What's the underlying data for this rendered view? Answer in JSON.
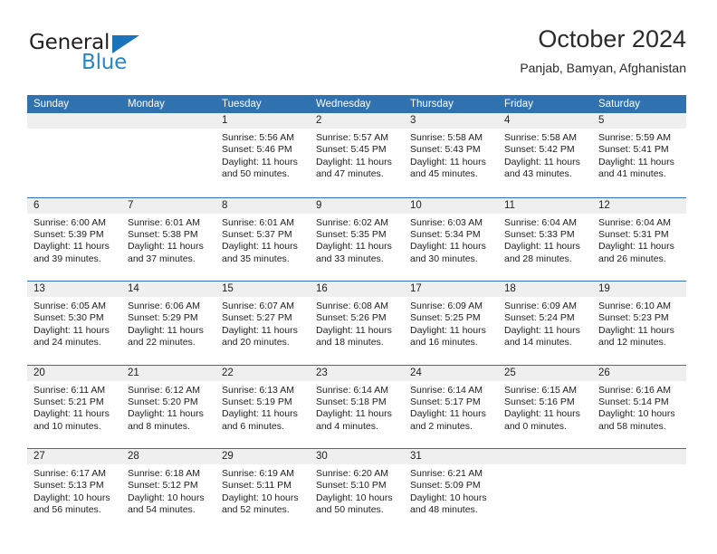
{
  "brand": {
    "name_part1": "General",
    "name_part2": "Blue",
    "triangle_color": "#1b74bb",
    "blue_color": "#2487c8"
  },
  "header": {
    "title": "October 2024",
    "subtitle": "Panjab, Bamyan, Afghanistan"
  },
  "theme": {
    "header_blue": "#3071b0",
    "day_band_gray": "#efefef",
    "text_color": "#222222"
  },
  "weekday_headers": [
    "Sunday",
    "Monday",
    "Tuesday",
    "Wednesday",
    "Thursday",
    "Friday",
    "Saturday"
  ],
  "weeks": [
    [
      {
        "empty": true
      },
      {
        "empty": true
      },
      {
        "day": "1",
        "sunrise": "Sunrise: 5:56 AM",
        "sunset": "Sunset: 5:46 PM",
        "daylight": "Daylight: 11 hours and 50 minutes."
      },
      {
        "day": "2",
        "sunrise": "Sunrise: 5:57 AM",
        "sunset": "Sunset: 5:45 PM",
        "daylight": "Daylight: 11 hours and 47 minutes."
      },
      {
        "day": "3",
        "sunrise": "Sunrise: 5:58 AM",
        "sunset": "Sunset: 5:43 PM",
        "daylight": "Daylight: 11 hours and 45 minutes."
      },
      {
        "day": "4",
        "sunrise": "Sunrise: 5:58 AM",
        "sunset": "Sunset: 5:42 PM",
        "daylight": "Daylight: 11 hours and 43 minutes."
      },
      {
        "day": "5",
        "sunrise": "Sunrise: 5:59 AM",
        "sunset": "Sunset: 5:41 PM",
        "daylight": "Daylight: 11 hours and 41 minutes."
      }
    ],
    [
      {
        "day": "6",
        "sunrise": "Sunrise: 6:00 AM",
        "sunset": "Sunset: 5:39 PM",
        "daylight": "Daylight: 11 hours and 39 minutes."
      },
      {
        "day": "7",
        "sunrise": "Sunrise: 6:01 AM",
        "sunset": "Sunset: 5:38 PM",
        "daylight": "Daylight: 11 hours and 37 minutes."
      },
      {
        "day": "8",
        "sunrise": "Sunrise: 6:01 AM",
        "sunset": "Sunset: 5:37 PM",
        "daylight": "Daylight: 11 hours and 35 minutes."
      },
      {
        "day": "9",
        "sunrise": "Sunrise: 6:02 AM",
        "sunset": "Sunset: 5:35 PM",
        "daylight": "Daylight: 11 hours and 33 minutes."
      },
      {
        "day": "10",
        "sunrise": "Sunrise: 6:03 AM",
        "sunset": "Sunset: 5:34 PM",
        "daylight": "Daylight: 11 hours and 30 minutes."
      },
      {
        "day": "11",
        "sunrise": "Sunrise: 6:04 AM",
        "sunset": "Sunset: 5:33 PM",
        "daylight": "Daylight: 11 hours and 28 minutes."
      },
      {
        "day": "12",
        "sunrise": "Sunrise: 6:04 AM",
        "sunset": "Sunset: 5:31 PM",
        "daylight": "Daylight: 11 hours and 26 minutes."
      }
    ],
    [
      {
        "day": "13",
        "sunrise": "Sunrise: 6:05 AM",
        "sunset": "Sunset: 5:30 PM",
        "daylight": "Daylight: 11 hours and 24 minutes."
      },
      {
        "day": "14",
        "sunrise": "Sunrise: 6:06 AM",
        "sunset": "Sunset: 5:29 PM",
        "daylight": "Daylight: 11 hours and 22 minutes."
      },
      {
        "day": "15",
        "sunrise": "Sunrise: 6:07 AM",
        "sunset": "Sunset: 5:27 PM",
        "daylight": "Daylight: 11 hours and 20 minutes."
      },
      {
        "day": "16",
        "sunrise": "Sunrise: 6:08 AM",
        "sunset": "Sunset: 5:26 PM",
        "daylight": "Daylight: 11 hours and 18 minutes."
      },
      {
        "day": "17",
        "sunrise": "Sunrise: 6:09 AM",
        "sunset": "Sunset: 5:25 PM",
        "daylight": "Daylight: 11 hours and 16 minutes."
      },
      {
        "day": "18",
        "sunrise": "Sunrise: 6:09 AM",
        "sunset": "Sunset: 5:24 PM",
        "daylight": "Daylight: 11 hours and 14 minutes."
      },
      {
        "day": "19",
        "sunrise": "Sunrise: 6:10 AM",
        "sunset": "Sunset: 5:23 PM",
        "daylight": "Daylight: 11 hours and 12 minutes."
      }
    ],
    [
      {
        "day": "20",
        "sunrise": "Sunrise: 6:11 AM",
        "sunset": "Sunset: 5:21 PM",
        "daylight": "Daylight: 11 hours and 10 minutes."
      },
      {
        "day": "21",
        "sunrise": "Sunrise: 6:12 AM",
        "sunset": "Sunset: 5:20 PM",
        "daylight": "Daylight: 11 hours and 8 minutes."
      },
      {
        "day": "22",
        "sunrise": "Sunrise: 6:13 AM",
        "sunset": "Sunset: 5:19 PM",
        "daylight": "Daylight: 11 hours and 6 minutes."
      },
      {
        "day": "23",
        "sunrise": "Sunrise: 6:14 AM",
        "sunset": "Sunset: 5:18 PM",
        "daylight": "Daylight: 11 hours and 4 minutes."
      },
      {
        "day": "24",
        "sunrise": "Sunrise: 6:14 AM",
        "sunset": "Sunset: 5:17 PM",
        "daylight": "Daylight: 11 hours and 2 minutes."
      },
      {
        "day": "25",
        "sunrise": "Sunrise: 6:15 AM",
        "sunset": "Sunset: 5:16 PM",
        "daylight": "Daylight: 11 hours and 0 minutes."
      },
      {
        "day": "26",
        "sunrise": "Sunrise: 6:16 AM",
        "sunset": "Sunset: 5:14 PM",
        "daylight": "Daylight: 10 hours and 58 minutes."
      }
    ],
    [
      {
        "day": "27",
        "sunrise": "Sunrise: 6:17 AM",
        "sunset": "Sunset: 5:13 PM",
        "daylight": "Daylight: 10 hours and 56 minutes."
      },
      {
        "day": "28",
        "sunrise": "Sunrise: 6:18 AM",
        "sunset": "Sunset: 5:12 PM",
        "daylight": "Daylight: 10 hours and 54 minutes."
      },
      {
        "day": "29",
        "sunrise": "Sunrise: 6:19 AM",
        "sunset": "Sunset: 5:11 PM",
        "daylight": "Daylight: 10 hours and 52 minutes."
      },
      {
        "day": "30",
        "sunrise": "Sunrise: 6:20 AM",
        "sunset": "Sunset: 5:10 PM",
        "daylight": "Daylight: 10 hours and 50 minutes."
      },
      {
        "day": "31",
        "sunrise": "Sunrise: 6:21 AM",
        "sunset": "Sunset: 5:09 PM",
        "daylight": "Daylight: 10 hours and 48 minutes."
      },
      {
        "empty": true
      },
      {
        "empty": true
      }
    ]
  ]
}
